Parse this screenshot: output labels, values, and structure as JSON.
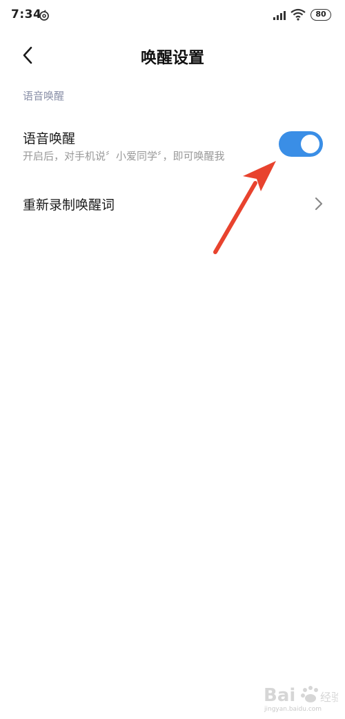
{
  "status_bar": {
    "time": "7:34",
    "battery": "80",
    "app_icon": "netease-music-icon",
    "signal_icon": "signal-icon",
    "wifi_icon": "wifi-icon"
  },
  "header": {
    "title": "唤醒设置",
    "back_icon": "back-arrow-icon"
  },
  "section": {
    "label": "语音唤醒"
  },
  "voice_wake": {
    "title": "语音唤醒",
    "subtitle": "开启后，对手机说〞小爱同学〞，即可唤醒我",
    "enabled": true,
    "toggle_color": "#3a8ee6"
  },
  "rerecord": {
    "title": "重新录制唤醒词",
    "chevron_icon": "chevron-right-icon"
  },
  "colors": {
    "accent": "#3a8ee6",
    "annotation": "#e8432e",
    "section_label": "#8a90a8"
  },
  "watermark": {
    "text": "jingyan.baidu.com"
  }
}
